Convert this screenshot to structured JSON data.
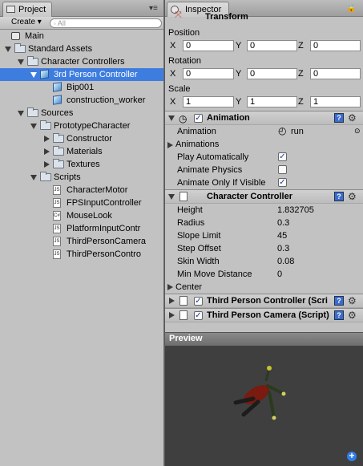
{
  "project": {
    "tab_label": "Project",
    "create_label": "Create",
    "create_arrow": "▾",
    "search_placeholder": "All",
    "search_icon": "magnifier-icon",
    "tree": [
      {
        "label": "Main",
        "depth": 0,
        "icon": "unity-scene-icon",
        "toggle": "none"
      },
      {
        "label": "Standard Assets",
        "depth": 0,
        "icon": "folder-icon",
        "toggle": "down"
      },
      {
        "label": "Character Controllers",
        "depth": 1,
        "icon": "folder-icon",
        "toggle": "down"
      },
      {
        "label": "3rd Person Controller",
        "depth": 2,
        "icon": "prefab-cube-icon",
        "toggle": "down",
        "selected": true
      },
      {
        "label": "Bip001",
        "depth": 3,
        "icon": "prefab-cube-icon",
        "toggle": "none"
      },
      {
        "label": "construction_worker",
        "depth": 3,
        "icon": "prefab-cube-icon",
        "toggle": "none"
      },
      {
        "label": "Sources",
        "depth": 1,
        "icon": "folder-icon",
        "toggle": "down"
      },
      {
        "label": "PrototypeCharacter",
        "depth": 2,
        "icon": "folder-icon",
        "toggle": "down"
      },
      {
        "label": "Constructor",
        "depth": 3,
        "icon": "folder-icon",
        "toggle": "right"
      },
      {
        "label": "Materials",
        "depth": 3,
        "icon": "folder-icon",
        "toggle": "right"
      },
      {
        "label": "Textures",
        "depth": 3,
        "icon": "folder-icon",
        "toggle": "right"
      },
      {
        "label": "Scripts",
        "depth": 2,
        "icon": "folder-icon",
        "toggle": "down"
      },
      {
        "label": "CharacterMotor",
        "depth": 3,
        "icon": "js-script-icon",
        "toggle": "none"
      },
      {
        "label": "FPSInputController",
        "depth": 3,
        "icon": "js-script-icon",
        "toggle": "none"
      },
      {
        "label": "MouseLook",
        "depth": 3,
        "icon": "cs-script-icon",
        "toggle": "none"
      },
      {
        "label": "PlatformInputContr",
        "depth": 3,
        "icon": "js-script-icon",
        "toggle": "none"
      },
      {
        "label": "ThirdPersonCamera",
        "depth": 3,
        "icon": "js-script-icon",
        "toggle": "none"
      },
      {
        "label": "ThirdPersonContro",
        "depth": 3,
        "icon": "js-script-icon",
        "toggle": "none"
      }
    ]
  },
  "inspector": {
    "tab_label": "Inspector",
    "transform": {
      "title": "Transform",
      "position_label": "Position",
      "rotation_label": "Rotation",
      "scale_label": "Scale",
      "axis_x": "X",
      "axis_y": "Y",
      "axis_z": "Z",
      "position": {
        "x": "0",
        "y": "0",
        "z": "0"
      },
      "rotation": {
        "x": "0",
        "y": "0",
        "z": "0"
      },
      "scale": {
        "x": "1",
        "y": "1",
        "z": "1"
      }
    },
    "animation": {
      "title": "Animation",
      "enabled": true,
      "animation_label": "Animation",
      "animation_value": "run",
      "animations_label": "Animations",
      "play_auto_label": "Play Automatically",
      "play_auto": true,
      "physics_label": "Animate Physics",
      "physics": false,
      "visible_label": "Animate Only If Visible",
      "visible": true
    },
    "char_controller": {
      "title": "Character Controller",
      "props": [
        {
          "label": "Height",
          "value": "1.832705"
        },
        {
          "label": "Radius",
          "value": "0.3"
        },
        {
          "label": "Slope Limit",
          "value": "45"
        },
        {
          "label": "Step Offset",
          "value": "0.3"
        },
        {
          "label": "Skin Width",
          "value": "0.08"
        },
        {
          "label": "Min Move Distance",
          "value": "0"
        }
      ],
      "center_label": "Center"
    },
    "script1_title": "Third Person Controller (Scri",
    "script2_title": "Third Person Camera (Script)",
    "preview_label": "Preview"
  },
  "colors": {
    "selection": "#3e7de0",
    "panel": "#c2c2c2",
    "preview_bg": "#3f3f3f",
    "character_body": "#7a1a10"
  }
}
